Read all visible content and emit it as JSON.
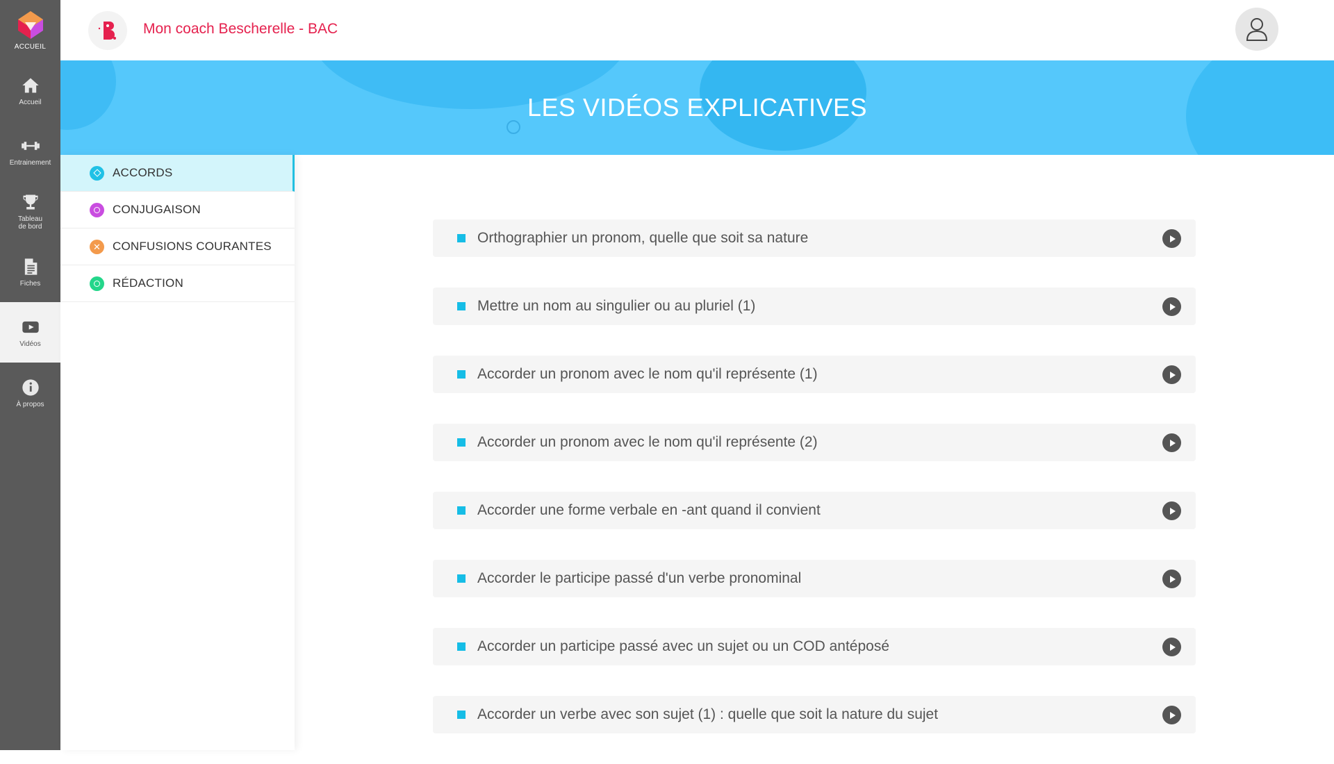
{
  "rail": {
    "logo_label": "ACCUEIL",
    "items": [
      {
        "label": "Accueil",
        "icon": "home-icon"
      },
      {
        "label": "Entrainement",
        "icon": "dumbbell-icon"
      },
      {
        "label": "Tableau\nde bord",
        "icon": "trophy-icon"
      },
      {
        "label": "Fiches",
        "icon": "document-icon"
      },
      {
        "label": "Vidéos",
        "icon": "video-icon"
      },
      {
        "label": "À propos",
        "icon": "info-icon"
      }
    ],
    "active": "Vidéos"
  },
  "header": {
    "title": "Mon coach Bescherelle - BAC",
    "brand_color": "#e5214e"
  },
  "banner": {
    "title": "LES VIDÉOS EXPLICATIVES",
    "color": "#55c8fb"
  },
  "categories": [
    {
      "label": "ACCORDS",
      "color": "#1fc1e6",
      "symbol": "diamond",
      "active": true
    },
    {
      "label": "CONJUGAISON",
      "color": "#c94de0",
      "symbol": "circle",
      "active": false
    },
    {
      "label": "CONFUSIONS COURANTES",
      "color": "#f39a4c",
      "symbol": "cross",
      "active": false
    },
    {
      "label": "RÉDACTION",
      "color": "#24d68a",
      "symbol": "circle",
      "active": false
    }
  ],
  "videos": [
    "Orthographier un pronom, quelle que soit sa nature",
    "Mettre un nom au singulier ou au pluriel (1)",
    "Accorder un pronom avec le nom qu'il représente (1)",
    "Accorder un pronom avec le nom qu'il représente (2)",
    "Accorder une forme verbale en -ant quand il convient",
    "Accorder le participe passé d'un verbe pronominal",
    "Accorder un participe passé avec un sujet ou un COD antéposé",
    "Accorder un verbe avec son sujet (1) : quelle que soit la nature du sujet"
  ]
}
